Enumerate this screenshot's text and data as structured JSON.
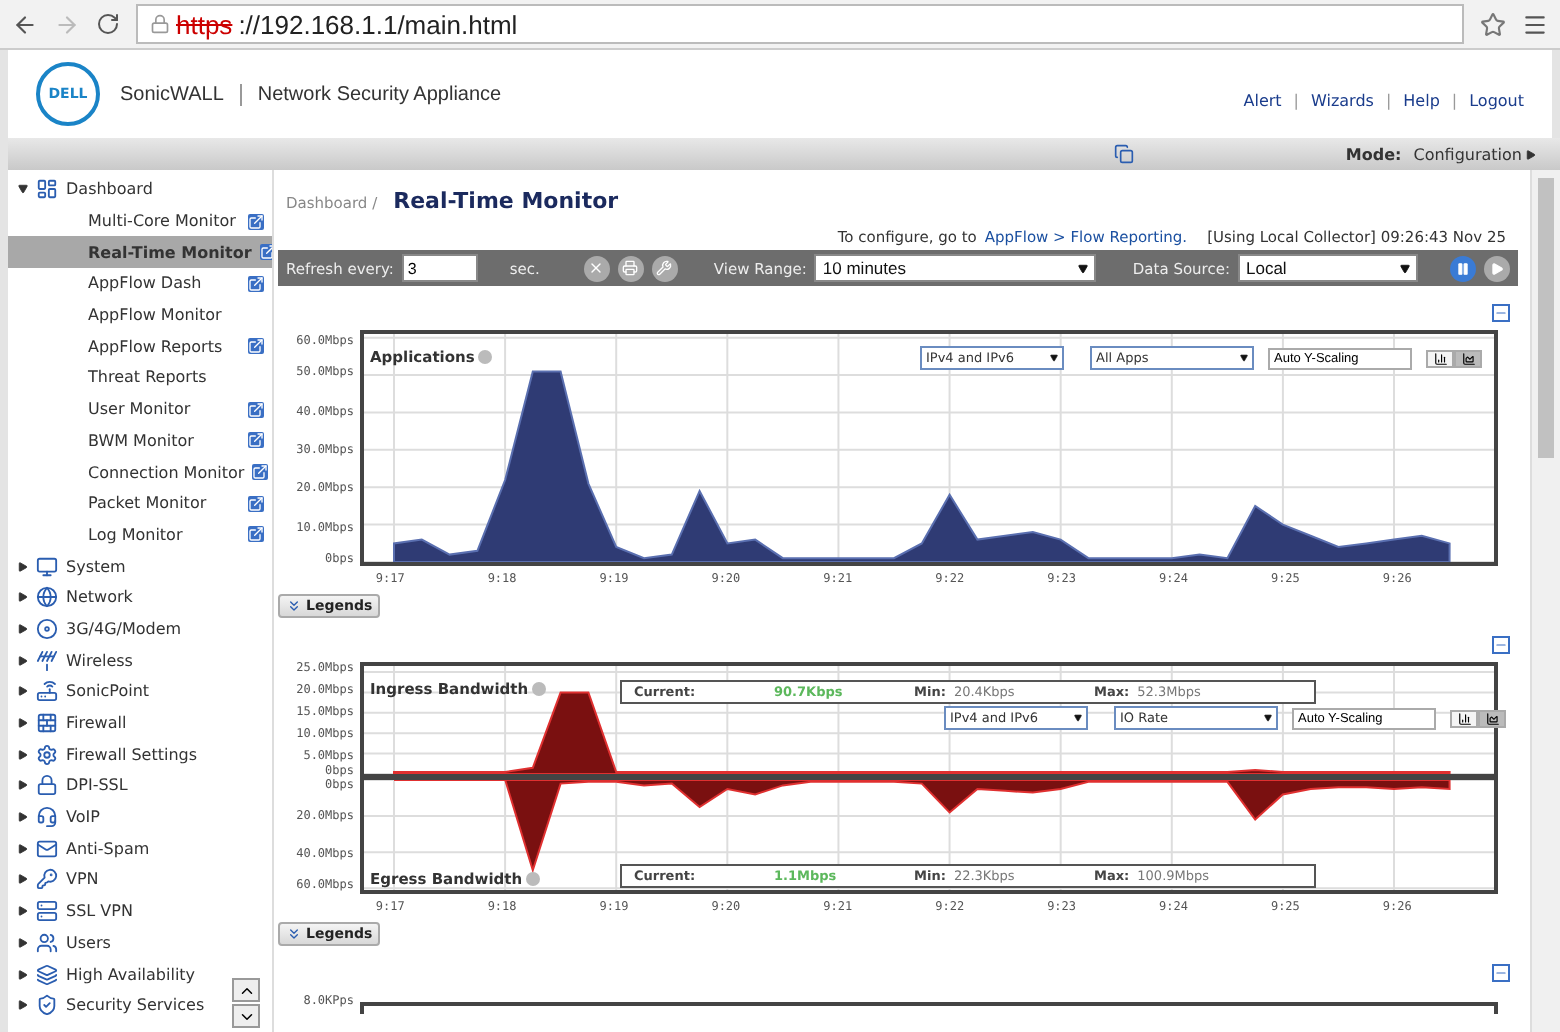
{
  "browser": {
    "url_scheme": "https",
    "url_rest": "://192.168.1.1/main.html"
  },
  "header": {
    "logo": "DELL",
    "brand": "SonicWALL",
    "product": "Network Security Appliance",
    "separator": "|",
    "links": [
      "Alert",
      "Wizards",
      "Help",
      "Logout"
    ]
  },
  "mode_bar": {
    "label": "Mode:",
    "value": "Configuration"
  },
  "sidebar": {
    "items": [
      {
        "label": "Dashboard",
        "expanded": true,
        "children": [
          {
            "label": "Multi-Core Monitor",
            "selected": false,
            "popout": true
          },
          {
            "label": "Real-Time Monitor",
            "selected": true,
            "popout": true
          },
          {
            "label": "AppFlow Dash",
            "selected": false,
            "popout": true
          },
          {
            "label": "AppFlow Monitor",
            "selected": false,
            "popout": false
          },
          {
            "label": "AppFlow Reports",
            "selected": false,
            "popout": true
          },
          {
            "label": "Threat Reports",
            "selected": false,
            "popout": false
          },
          {
            "label": "User Monitor",
            "selected": false,
            "popout": true
          },
          {
            "label": "BWM Monitor",
            "selected": false,
            "popout": true
          },
          {
            "label": "Connection Monitor",
            "selected": false,
            "popout": true
          },
          {
            "label": "Packet Monitor",
            "selected": false,
            "popout": true
          },
          {
            "label": "Log Monitor",
            "selected": false,
            "popout": true
          }
        ]
      },
      {
        "label": "System",
        "expanded": false
      },
      {
        "label": "Network",
        "expanded": false
      },
      {
        "label": "3G/4G/Modem",
        "expanded": false
      },
      {
        "label": "Wireless",
        "expanded": false
      },
      {
        "label": "SonicPoint",
        "expanded": false
      },
      {
        "label": "Firewall",
        "expanded": false
      },
      {
        "label": "Firewall Settings",
        "expanded": false
      },
      {
        "label": "DPI-SSL",
        "expanded": false
      },
      {
        "label": "VoIP",
        "expanded": false
      },
      {
        "label": "Anti-Spam",
        "expanded": false
      },
      {
        "label": "VPN",
        "expanded": false
      },
      {
        "label": "SSL VPN",
        "expanded": false
      },
      {
        "label": "Users",
        "expanded": false
      },
      {
        "label": "High Availability",
        "expanded": false
      },
      {
        "label": "Security Services",
        "expanded": false
      }
    ]
  },
  "page": {
    "breadcrumb": "Dashboard /",
    "title": "Real-Time Monitor",
    "config_prefix": "To configure, go to",
    "config_link": "AppFlow > Flow Reporting.",
    "status": "[Using Local Collector] 09:26:43 Nov 25"
  },
  "toolbar": {
    "refresh_label": "Refresh every:",
    "refresh_value": "3",
    "refresh_unit": "sec.",
    "range_label": "View Range:",
    "range_value": "10 minutes",
    "source_label": "Data Source:",
    "source_value": "Local",
    "paused": false
  },
  "charts": [
    {
      "ip": "IPv4 and IPv6",
      "filter": "All Apps",
      "scaling": "Auto Y-Scaling",
      "legends": "Legends",
      "view_modes": [
        {
          "kind": "bar",
          "selected": false
        },
        {
          "kind": "area",
          "selected": true
        }
      ],
      "panels": [
        {
          "title": "Applications",
          "title_below": false,
          "chart_data": {
            "type": "area",
            "grid": true,
            "x": [
              557,
              557.25,
              557.5,
              557.75,
              558,
              558.25,
              558.5,
              558.75,
              559,
              559.25,
              559.5,
              559.75,
              560,
              560.25,
              560.5,
              560.75,
              561,
              561.25,
              561.5,
              561.75,
              562,
              562.25,
              562.5,
              562.75,
              563,
              563.25,
              563.5,
              563.75,
              564,
              564.25,
              564.5,
              564.75,
              565,
              565.25,
              565.5,
              565.75,
              566,
              566.25,
              566.5
            ],
            "values": [
              5,
              6,
              2,
              3,
              22,
              51,
              51,
              21,
              4,
              1,
              2,
              19,
              5,
              6,
              1,
              1,
              1,
              1,
              1,
              5,
              18,
              6,
              7,
              8,
              6,
              1,
              1,
              1,
              1,
              2,
              1,
              15,
              10,
              7,
              4,
              5,
              6,
              7,
              5
            ],
            "xlim": [
              556.73,
              566.9
            ],
            "ylim": [
              0,
              61
            ],
            "xticks": [
              {
                "value": 557,
                "label": "9:17"
              },
              {
                "value": 558,
                "label": "9:18"
              },
              {
                "value": 559,
                "label": "9:19"
              },
              {
                "value": 560,
                "label": "9:20"
              },
              {
                "value": 561,
                "label": "9:21"
              },
              {
                "value": 562,
                "label": "9:22"
              },
              {
                "value": 563,
                "label": "9:23"
              },
              {
                "value": 564,
                "label": "9:24"
              },
              {
                "value": 565,
                "label": "9:25"
              },
              {
                "value": 566,
                "label": "9:26"
              }
            ],
            "yticks": [
              {
                "value": 60,
                "label": "60.0Mbps"
              },
              {
                "value": 50,
                "label": "50.0Mbps"
              },
              {
                "value": 40,
                "label": "40.0Mbps"
              },
              {
                "value": 30,
                "label": "30.0Mbps"
              },
              {
                "value": 20,
                "label": "20.0Mbps"
              },
              {
                "value": 10,
                "label": "10.0Mbps"
              },
              {
                "value": 0,
                "label": "0bps"
              }
            ]
          }
        }
      ]
    },
    {
      "ip": "IPv4 and IPv6",
      "filter": "IO Rate",
      "scaling": "Auto Y-Scaling",
      "legends": "Legends",
      "view_modes": [
        {
          "kind": "bar",
          "selected": false
        },
        {
          "kind": "area",
          "selected": true
        }
      ],
      "panels": [
        {
          "title": "Ingress Bandwidth",
          "title_below": false,
          "stats": [
            {
              "label": "Current:",
              "value": "90.7Kbps",
              "highlight": true
            },
            {
              "label": "Min:",
              "value": "20.4Kbps",
              "highlight": false
            },
            {
              "label": "Max:",
              "value": "52.3Mbps",
              "highlight": false
            }
          ],
          "chart_data": {
            "type": "area",
            "grid": true,
            "x": [
              557,
              557.25,
              557.5,
              557.75,
              558,
              558.25,
              558.5,
              558.75,
              559,
              559.25,
              559.5,
              559.75,
              560,
              560.25,
              560.5,
              560.75,
              561,
              561.25,
              561.5,
              561.75,
              562,
              562.25,
              562.5,
              562.75,
              563,
              563.25,
              563.5,
              563.75,
              564,
              564.25,
              564.5,
              564.75,
              565,
              565.25,
              565.5,
              565.75,
              566,
              566.25,
              566.5
            ],
            "values": [
              0.5,
              0.5,
              0.5,
              0.5,
              0.5,
              1.5,
              20,
              20,
              0.5,
              0.5,
              0.5,
              0.5,
              0.5,
              0.5,
              0.5,
              0.5,
              0.5,
              0.5,
              0.5,
              0.5,
              0.5,
              0.5,
              0.5,
              0.5,
              0.5,
              0.5,
              0.5,
              0.5,
              0.5,
              0.5,
              0.5,
              1,
              0.5,
              0.5,
              0.5,
              0.5,
              0.5,
              0.5,
              0.5
            ],
            "xlim": [
              556.73,
              566.9
            ],
            "ylim": [
              0,
              26.5
            ],
            "yticks": [
              {
                "value": 25,
                "label": "25.0Mbps"
              },
              {
                "value": 20,
                "label": "20.0Mbps"
              },
              {
                "value": 15,
                "label": "15.0Mbps"
              },
              {
                "value": 10,
                "label": "10.0Mbps"
              },
              {
                "value": 5,
                "label": "5.0Mbps"
              },
              {
                "value": 0,
                "label": "0bps"
              }
            ]
          }
        },
        {
          "title": "Egress Bandwidth",
          "title_below": true,
          "stats": [
            {
              "label": "Current:",
              "value": "1.1Mbps",
              "highlight": true
            },
            {
              "label": "Min:",
              "value": "22.3Kbps",
              "highlight": false
            },
            {
              "label": "Max:",
              "value": "100.9Mbps",
              "highlight": false
            }
          ],
          "chart_data": {
            "type": "area",
            "grid": true,
            "x": [
              557,
              557.25,
              557.5,
              557.75,
              558,
              558.25,
              558.5,
              558.75,
              559,
              559.25,
              559.5,
              559.75,
              560,
              560.25,
              560.5,
              560.75,
              561,
              561.25,
              561.5,
              561.75,
              562,
              562.25,
              562.5,
              562.75,
              563,
              563.25,
              563.5,
              563.75,
              564,
              564.25,
              564.5,
              564.75,
              565,
              565.25,
              565.5,
              565.75,
              566,
              566.25,
              566.5
            ],
            "values": [
              0,
              0,
              0,
              0,
              0,
              50,
              2,
              1,
              1,
              3,
              2,
              15,
              5,
              8,
              3,
              1,
              1,
              1,
              1,
              2,
              18,
              5,
              6,
              7,
              5,
              1,
              1,
              1,
              1,
              1,
              1,
              22,
              8,
              5,
              4,
              4,
              5,
              4,
              5
            ],
            "xlim": [
              556.73,
              566.9
            ],
            "ylim": [
              61,
              0
            ],
            "xticks": [
              {
                "value": 557,
                "label": "9:17"
              },
              {
                "value": 558,
                "label": "9:18"
              },
              {
                "value": 559,
                "label": "9:19"
              },
              {
                "value": 560,
                "label": "9:20"
              },
              {
                "value": 561,
                "label": "9:21"
              },
              {
                "value": 562,
                "label": "9:22"
              },
              {
                "value": 563,
                "label": "9:23"
              },
              {
                "value": 564,
                "label": "9:24"
              },
              {
                "value": 565,
                "label": "9:25"
              },
              {
                "value": 566,
                "label": "9:26"
              }
            ],
            "yticks": [
              {
                "value": 0,
                "label": "0bps"
              },
              {
                "value": 20,
                "label": "20.0Mbps"
              },
              {
                "value": 40,
                "label": "40.0Mbps"
              },
              {
                "value": 60,
                "label": "60.0Mbps"
              }
            ]
          }
        }
      ]
    }
  ],
  "next_chart": {
    "top_tick": "8.0KPps"
  }
}
